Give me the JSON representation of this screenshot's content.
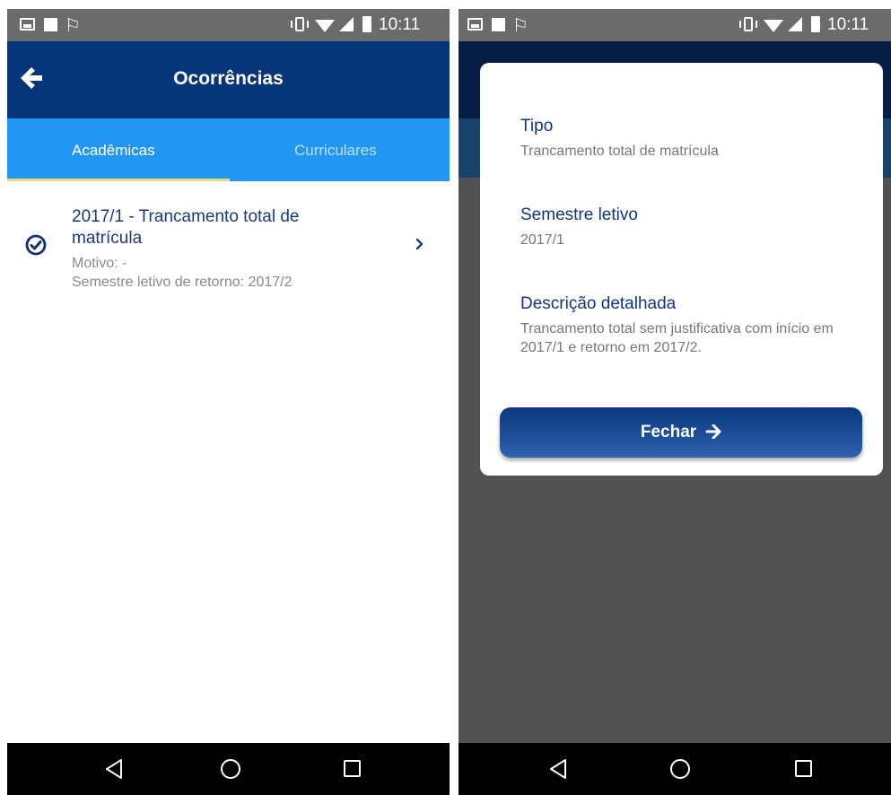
{
  "status_bar": {
    "time": "10:11"
  },
  "screen_list": {
    "app_bar": {
      "title": "Ocorrências"
    },
    "tabs": [
      {
        "label": "Acadêmicas",
        "selected": true
      },
      {
        "label": "Curriculares",
        "selected": false
      }
    ],
    "items": [
      {
        "title": "2017/1 - Trancamento total de matrícula",
        "reason": "Motivo: -",
        "return_semester": "Semestre letivo de retorno: 2017/2"
      }
    ]
  },
  "dialog": {
    "fields": [
      {
        "label": "Tipo",
        "value": "Trancamento total de matrícula"
      },
      {
        "label": "Semestre letivo",
        "value": "2017/1"
      },
      {
        "label": "Descrição detalhada",
        "value": "Trancamento total sem justificativa com início em 2017/1 e retorno em 2017/2."
      }
    ],
    "close_button": "Fechar"
  },
  "colors": {
    "app_bar": "#06357a",
    "tabs": "#2196f3",
    "tab_indicator": "#e4e07a",
    "dialog_label": "#113580",
    "overlay": "#525252"
  }
}
